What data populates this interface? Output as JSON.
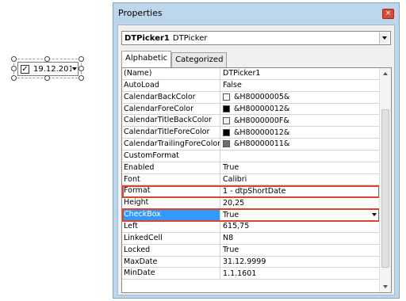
{
  "control": {
    "checked_glyph": "✓",
    "date_text": "19.12.201"
  },
  "window": {
    "title": "Properties",
    "close_glyph": "×",
    "object_name": "DTPicker1",
    "object_type": "DTPicker",
    "tabs": [
      {
        "label": "Alphabetic"
      },
      {
        "label": "Categorized"
      }
    ],
    "active_tab": "Alphabetic",
    "selected_property": "CheckBox",
    "highlighted_properties": [
      "Format",
      "CheckBox"
    ],
    "properties": [
      {
        "name": "(Name)",
        "value": "DTPicker1"
      },
      {
        "name": "AutoLoad",
        "value": "False"
      },
      {
        "name": "CalendarBackColor",
        "value": "&H80000005&",
        "swatch": "#ffffff"
      },
      {
        "name": "CalendarForeColor",
        "value": "&H80000012&",
        "swatch": "#000000"
      },
      {
        "name": "CalendarTitleBackColor",
        "value": "&H8000000F&",
        "swatch": "#f0f0f0"
      },
      {
        "name": "CalendarTitleForeColor",
        "value": "&H80000012&",
        "swatch": "#000000"
      },
      {
        "name": "CalendarTrailingForeColor",
        "value": "&H80000011&",
        "swatch": "#6d6d6d"
      },
      {
        "name": "CustomFormat",
        "value": ""
      },
      {
        "name": "Enabled",
        "value": "True"
      },
      {
        "name": "Font",
        "value": "Calibri"
      },
      {
        "name": "Format",
        "value": "1 - dtpShortDate"
      },
      {
        "name": "Height",
        "value": "20,25"
      },
      {
        "name": "CheckBox",
        "value": "True",
        "dropdown": true
      },
      {
        "name": "Left",
        "value": "615,75"
      },
      {
        "name": "LinkedCell",
        "value": "N8"
      },
      {
        "name": "Locked",
        "value": "True"
      },
      {
        "name": "MaxDate",
        "value": "31.12.9999"
      },
      {
        "name": "MinDate",
        "value": "1.1.1601"
      }
    ]
  },
  "colors": {
    "window_frame": "#bcd6ec",
    "selection": "#3399ff",
    "highlight_box": "#d9452f",
    "close_button": "#d34c3a"
  }
}
